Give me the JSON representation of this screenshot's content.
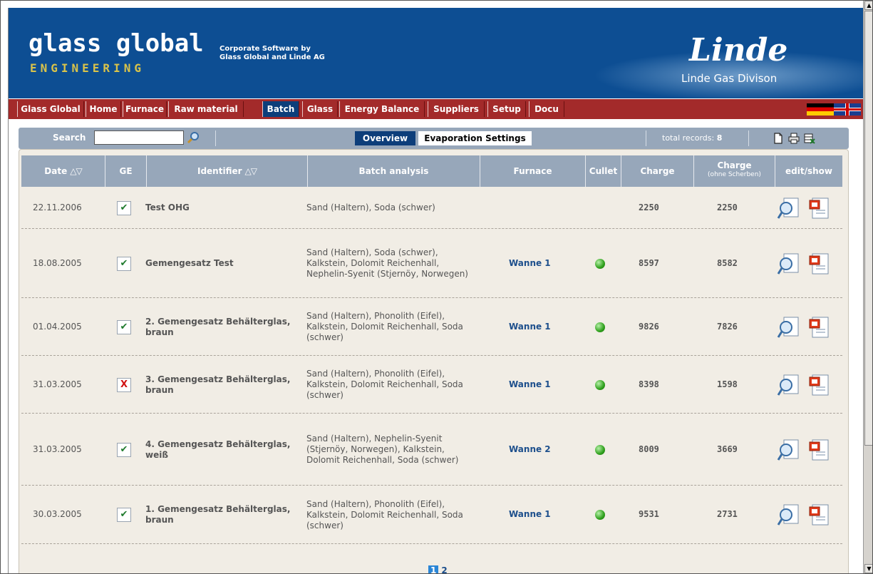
{
  "header": {
    "logo_main": "glass global",
    "logo_sub": "ENGINEERING",
    "corporate_line1": "Corporate Software by",
    "corporate_line2": "Glass Global and Linde AG",
    "brand": "Linde",
    "division": "Linde Gas Divison"
  },
  "nav": {
    "items": [
      "Glass Global",
      "Home",
      "Furnace",
      "Raw material",
      "Batch",
      "Glass",
      "Energy Balance",
      "Suppliers",
      "Setup",
      "Docu"
    ],
    "active": "Batch",
    "flags": [
      "german-flag-icon",
      "uk-flag-icon"
    ]
  },
  "toolbar": {
    "search_label": "Search",
    "search_value": "",
    "tab_overview": "Overview",
    "tab_evaporation": "Evaporation Settings",
    "total_label": "total records:",
    "total_count": "8",
    "icons": [
      "new-document-icon",
      "print-icon",
      "export-excel-icon"
    ]
  },
  "table": {
    "headers": {
      "date": "Date",
      "ge": "GE",
      "identifier": "Identifier",
      "batch_analysis": "Batch analysis",
      "furnace": "Furnace",
      "cullet": "Cullet",
      "charge": "Charge",
      "charge2": "Charge",
      "charge2_sub": "(ohne Scherben)",
      "edit_show": "edit/show"
    },
    "sort_glyph": "△▽",
    "ge_ok": "✔",
    "ge_no": "X",
    "rows": [
      {
        "date": "22.11.2006",
        "ge": "ok",
        "identifier": "Test OHG",
        "batch": "Sand (Haltern), Soda (schwer)",
        "furnace": "",
        "cullet": false,
        "charge": "2250",
        "charge2": "2250"
      },
      {
        "date": "18.08.2005",
        "ge": "ok",
        "identifier": "Gemengesatz Test",
        "batch": "Sand (Haltern), Soda (schwer), Kalkstein, Dolomit Reichenhall, Nephelin-Syenit (Stjernöy, Norwegen)",
        "furnace": "Wanne 1",
        "cullet": true,
        "charge": "8597",
        "charge2": "8582"
      },
      {
        "date": "01.04.2005",
        "ge": "ok",
        "identifier": "2. Gemengesatz Behälterglas, braun",
        "batch": "Sand (Haltern), Phonolith (Eifel), Kalkstein, Dolomit Reichenhall, Soda (schwer)",
        "furnace": "Wanne 1",
        "cullet": true,
        "charge": "9826",
        "charge2": "7826"
      },
      {
        "date": "31.03.2005",
        "ge": "no",
        "identifier": "3. Gemengesatz Behälterglas, braun",
        "batch": "Sand (Haltern), Phonolith (Eifel), Kalkstein, Dolomit Reichenhall, Soda (schwer)",
        "furnace": "Wanne 1",
        "cullet": true,
        "charge": "8398",
        "charge2": "1598"
      },
      {
        "date": "31.03.2005",
        "ge": "ok",
        "identifier": "4. Gemengesatz Behälterglas, weiß",
        "batch": "Sand (Haltern), Nephelin-Syenit (Stjernöy, Norwegen), Kalkstein, Dolomit Reichenhall, Soda (schwer)",
        "furnace": "Wanne 2",
        "cullet": true,
        "charge": "8009",
        "charge2": "3669"
      },
      {
        "date": "30.03.2005",
        "ge": "ok",
        "identifier": "1. Gemengesatz Behälterglas, braun",
        "batch": "Sand (Haltern), Phonolith (Eifel), Kalkstein, Dolomit Reichenhall, Soda (schwer)",
        "furnace": "Wanne 1",
        "cullet": true,
        "charge": "9531",
        "charge2": "2731"
      }
    ]
  },
  "pager": {
    "current": "1",
    "pages": [
      "2"
    ]
  },
  "colors": {
    "header_blue": "#0d4e93",
    "nav_red": "#a32a2a",
    "active_tab": "#0d3e7a",
    "table_header": "#97a7ba",
    "panel_bg": "#f1ede5",
    "link_blue": "#1d4f8c",
    "cullet_green": "#2fa01c"
  }
}
